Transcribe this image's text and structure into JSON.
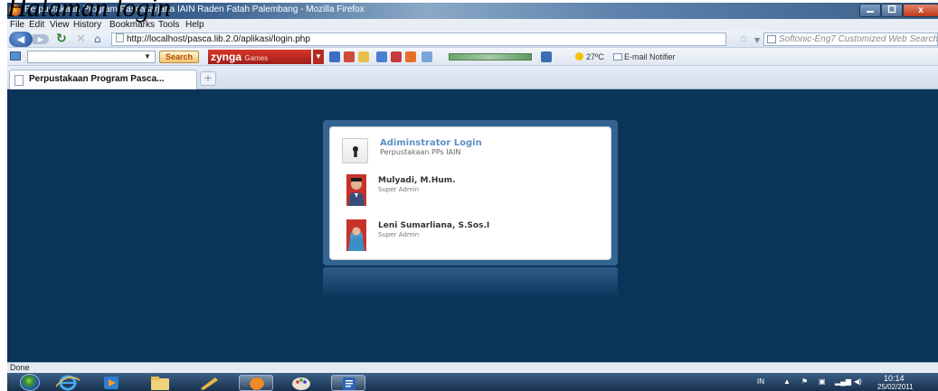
{
  "caption": "Halaman login",
  "window": {
    "title": "Perpustakaan Program Pascasarjana IAIN Raden Fatah Palembang - Mozilla Firefox",
    "close_glyph": "x"
  },
  "menu": {
    "items": [
      "File",
      "Edit",
      "View",
      "History",
      "Bookmarks",
      "Tools",
      "Help"
    ]
  },
  "nav": {
    "url": "http://localhost/pasca.lib.2.0/aplikasi/login.php",
    "search_placeholder": "Softonic-Eng7 Customized Web Search"
  },
  "toolbar": {
    "search_label": "Search",
    "zynga_label": "zynga",
    "zynga_sub": "Games",
    "temperature": "27ºC",
    "mail_label": "E-mail Notifier"
  },
  "tab": {
    "label": "Perpustakaan Program Pasca...",
    "new_tab": "+"
  },
  "login": {
    "title": "Adiminstrator Login",
    "subtitle": "Perpustakaan PPs IAIN",
    "users": [
      {
        "name": "Mulyadi, M.Hum.",
        "role": "Super Admin"
      },
      {
        "name": "Leni Sumarliana, S.Sos.I",
        "role": "Super Admin"
      }
    ]
  },
  "status": {
    "text": "Done"
  },
  "taskbar": {
    "lang": "IN",
    "time": "10:14",
    "date": "25/02/2011"
  },
  "colors": {
    "page_background": "#0b3459",
    "panel_background": "#ffffff",
    "login_title": "#5b8fc7"
  }
}
